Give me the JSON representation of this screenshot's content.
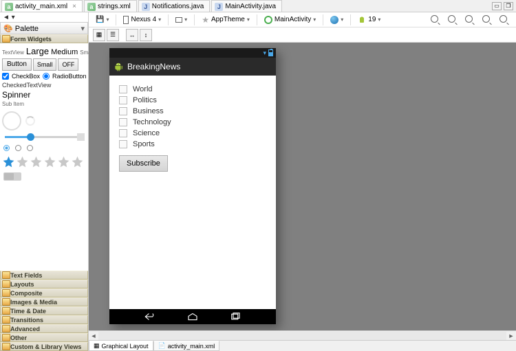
{
  "tabs": [
    {
      "label": "activity_main.xml",
      "type": "xml",
      "active": true,
      "closable": true
    },
    {
      "label": "strings.xml",
      "type": "xml",
      "active": false
    },
    {
      "label": "Notifications.java",
      "type": "java",
      "active": false
    },
    {
      "label": "MainActivity.java",
      "type": "java",
      "active": false
    }
  ],
  "palette": {
    "back": "◄ ▾",
    "title": "Palette",
    "drawers": {
      "form_widgets": "Form Widgets",
      "text_fields": "Text Fields",
      "layouts": "Layouts",
      "composite": "Composite",
      "images_media": "Images & Media",
      "time_date": "Time & Date",
      "transitions": "Transitions",
      "advanced": "Advanced",
      "other": "Other",
      "custom": "Custom & Library Views"
    },
    "fw": {
      "textview": "TextView",
      "large": "Large",
      "medium": "Medium",
      "small": "Small",
      "button": "Button",
      "btn_small": "Small",
      "off": "OFF",
      "checkbox": "CheckBox",
      "radio": "RadioButton",
      "ctv": "CheckedTextView",
      "spinner": "Spinner",
      "sub": "Sub Item"
    }
  },
  "toolbar": {
    "device": "Nexus 4",
    "theme": "AppTheme",
    "activity": "MainActivity",
    "api": "19"
  },
  "app": {
    "title": "BreakingNews",
    "categories": [
      "World",
      "Politics",
      "Business",
      "Technology",
      "Science",
      "Sports"
    ],
    "subscribe": "Subscribe"
  },
  "bottom": {
    "graphical": "Graphical Layout",
    "source": "activity_main.xml"
  }
}
